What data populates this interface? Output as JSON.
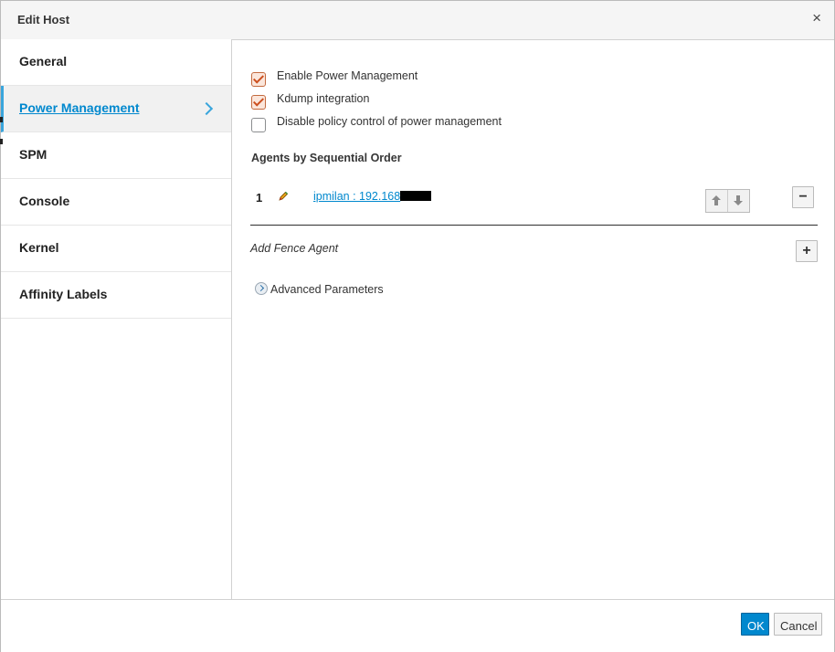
{
  "dialog": {
    "title": "Edit Host",
    "close_glyph": "×"
  },
  "sidebar": {
    "items": [
      {
        "label": "General",
        "active": false
      },
      {
        "label": "Power Management",
        "active": true
      },
      {
        "label": "SPM",
        "active": false
      },
      {
        "label": "Console",
        "active": false
      },
      {
        "label": "Kernel",
        "active": false
      },
      {
        "label": "Affinity Labels",
        "active": false
      }
    ]
  },
  "power_management": {
    "checkboxes": [
      {
        "label": "Enable Power Management",
        "checked": true
      },
      {
        "label": "Kdump integration",
        "checked": true
      },
      {
        "label": "Disable policy control of power management",
        "checked": false
      }
    ],
    "agents_title": "Agents by Sequential Order",
    "agents": [
      {
        "order": "1",
        "label": "ipmilan : 192.168"
      }
    ],
    "add_agent_label": "Add Fence Agent",
    "advanced_label": "Advanced Parameters",
    "remove_glyph": "−",
    "add_glyph": "+"
  },
  "footer": {
    "ok_label": "OK",
    "cancel_label": "Cancel"
  },
  "colors": {
    "accent": "#0088ce",
    "checkbox": "#cc4f1e",
    "active_border": "#39a5dc"
  }
}
